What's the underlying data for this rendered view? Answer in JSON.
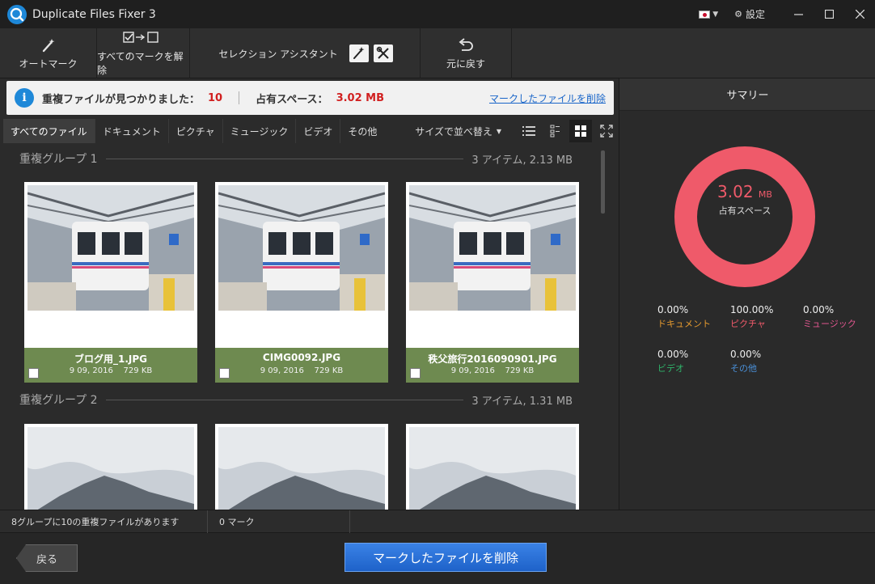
{
  "window": {
    "title": "Duplicate Files Fixer 3",
    "settings_label": "設定"
  },
  "toolbar": {
    "auto_mark": "オートマーク",
    "unmark_all": "すべてのマークを解除",
    "selection_assistant": "セレクション アシスタント",
    "undo": "元に戻す"
  },
  "infobar": {
    "found_label": "重複ファイルが見つかりました：",
    "found_count": "10",
    "space_label": "占有スペース：",
    "space_value": "3.02 MB",
    "delete_link": "マークしたファイルを削除"
  },
  "tabs": [
    "すべてのファイル",
    "ドキュメント",
    "ピクチャ",
    "ミュージック",
    "ビデオ",
    "その他"
  ],
  "sort_label": "サイズで並べ替え",
  "groups": [
    {
      "title": "重複グループ 1",
      "info": "3 アイテム, 2.13 MB",
      "files": [
        {
          "name": "ブログ用_1.JPG",
          "date": "9 09, 2016",
          "size": "729 KB"
        },
        {
          "name": "CIMG0092.JPG",
          "date": "9 09, 2016",
          "size": "729 KB"
        },
        {
          "name": "秩父旅行2016090901.JPG",
          "date": "9 09, 2016",
          "size": "729 KB"
        }
      ]
    },
    {
      "title": "重複グループ 2",
      "info": "3 アイテム, 1.31 MB"
    }
  ],
  "summary": {
    "title": "サマリー",
    "donut_value": "3.02",
    "donut_unit": "MB",
    "donut_label": "占有スペース",
    "stats": [
      {
        "pct": "0.00%",
        "name": "ドキュメント",
        "color": "#e59a2f"
      },
      {
        "pct": "100.00%",
        "name": "ピクチャ",
        "color": "#ef5a6a"
      },
      {
        "pct": "0.00%",
        "name": "ミュージック",
        "color": "#e0568e"
      },
      {
        "pct": "0.00%",
        "name": "ビデオ",
        "color": "#2fb36a"
      },
      {
        "pct": "0.00%",
        "name": "その他",
        "color": "#4a90d9"
      }
    ]
  },
  "statusbar": {
    "groups_text": "8グループに10の重複ファイルがあります",
    "marks_text": "0 マーク"
  },
  "footer": {
    "back": "戻る",
    "delete": "マークしたファイルを削除"
  }
}
